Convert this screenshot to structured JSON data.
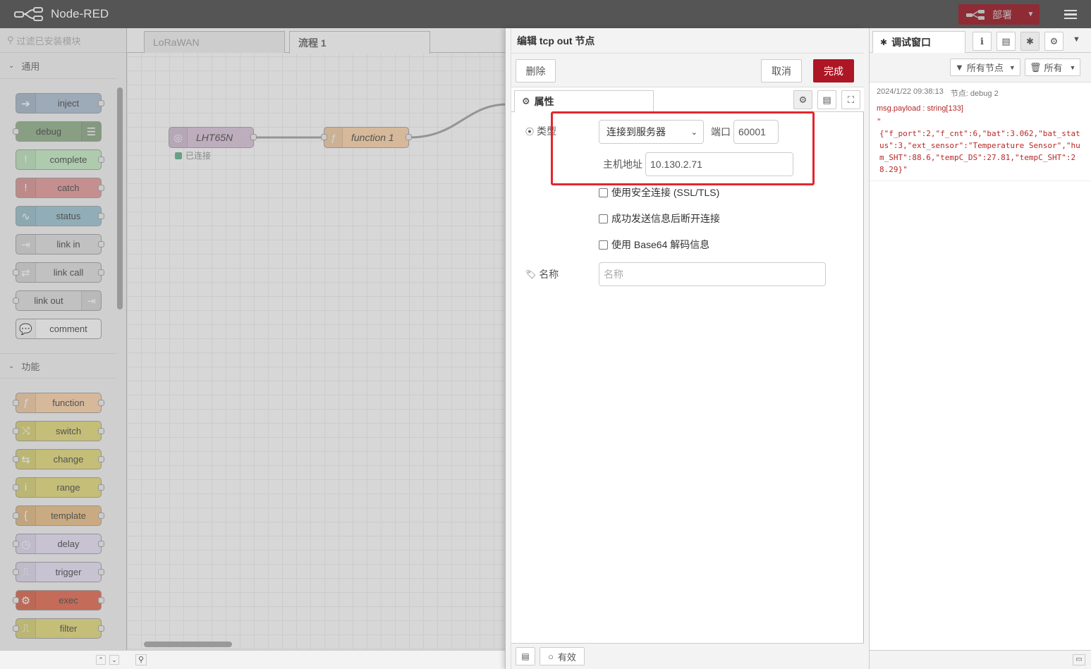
{
  "app": {
    "title": "Node-RED",
    "deploy_label": "部署"
  },
  "palette": {
    "search_placeholder": "过滤已安装模块",
    "categories": [
      {
        "label": "通用"
      },
      {
        "label": "功能"
      }
    ],
    "common_nodes": [
      {
        "label": "inject",
        "color": "#a6bbcf"
      },
      {
        "label": "debug",
        "color": "#87a980"
      },
      {
        "label": "complete",
        "color": "#c0edc0"
      },
      {
        "label": "catch",
        "color": "#e49191"
      },
      {
        "label": "status",
        "color": "#94c1d0"
      },
      {
        "label": "link in",
        "color": "#dddddd"
      },
      {
        "label": "link call",
        "color": "#dddddd"
      },
      {
        "label": "link out",
        "color": "#dddddd"
      },
      {
        "label": "comment",
        "color": "#ffffff"
      }
    ],
    "function_nodes": [
      {
        "label": "function",
        "color": "#fdd0a2"
      },
      {
        "label": "switch",
        "color": "#e2d96e"
      },
      {
        "label": "change",
        "color": "#e2d96e"
      },
      {
        "label": "range",
        "color": "#e2d96e"
      },
      {
        "label": "template",
        "color": "#ebbc7c"
      },
      {
        "label": "delay",
        "color": "#e6e0f8"
      },
      {
        "label": "trigger",
        "color": "#e6e0f8"
      },
      {
        "label": "exec",
        "color": "#e25a3f"
      },
      {
        "label": "filter",
        "color": "#e2d96e"
      }
    ]
  },
  "workspace": {
    "tabs": [
      {
        "label": "LoRaWAN"
      },
      {
        "label": "流程 1"
      }
    ],
    "nodes": [
      {
        "label": "LHT65N",
        "color": "#d8bfd8"
      },
      {
        "label": "function 1",
        "color": "#fdd0a2"
      }
    ],
    "status_text": "已连接"
  },
  "editor": {
    "title": "编辑 tcp out 节点",
    "delete_label": "删除",
    "cancel_label": "取消",
    "done_label": "完成",
    "properties_tab": "属性",
    "type_label": "类型",
    "type_value": "连接到服务器",
    "port_label": "端口",
    "port_value": "60001",
    "host_label": "主机地址",
    "host_value": "10.130.2.71",
    "checkbox_tls": "使用安全连接 (SSL/TLS)",
    "checkbox_close": "成功发送信息后断开连接",
    "checkbox_base64": "使用 Base64 解码信息",
    "name_label": "名称",
    "name_placeholder": "名称",
    "enabled_label": "有效"
  },
  "sidebar": {
    "debug_tab": "调试窗口",
    "filter_nodes": "所有节点",
    "filter_clear": "所有",
    "message": {
      "timestamp": "2024/1/22 09:38:13",
      "node": "节点: debug 2",
      "property": "msg.payload : string[133]",
      "quote": "\"",
      "payload": "{\"f_port\":2,\"f_cnt\":6,\"bat\":3.062,\"bat_status\":3,\"ext_sensor\":\"Temperature Sensor\",\"hum_SHT\":88.6,\"tempC_DS\":27.81,\"tempC_SHT\":28.29}\""
    }
  },
  "colors": {
    "accent": "#ad1625",
    "header": "#555555",
    "highlight": "#e4262c"
  }
}
